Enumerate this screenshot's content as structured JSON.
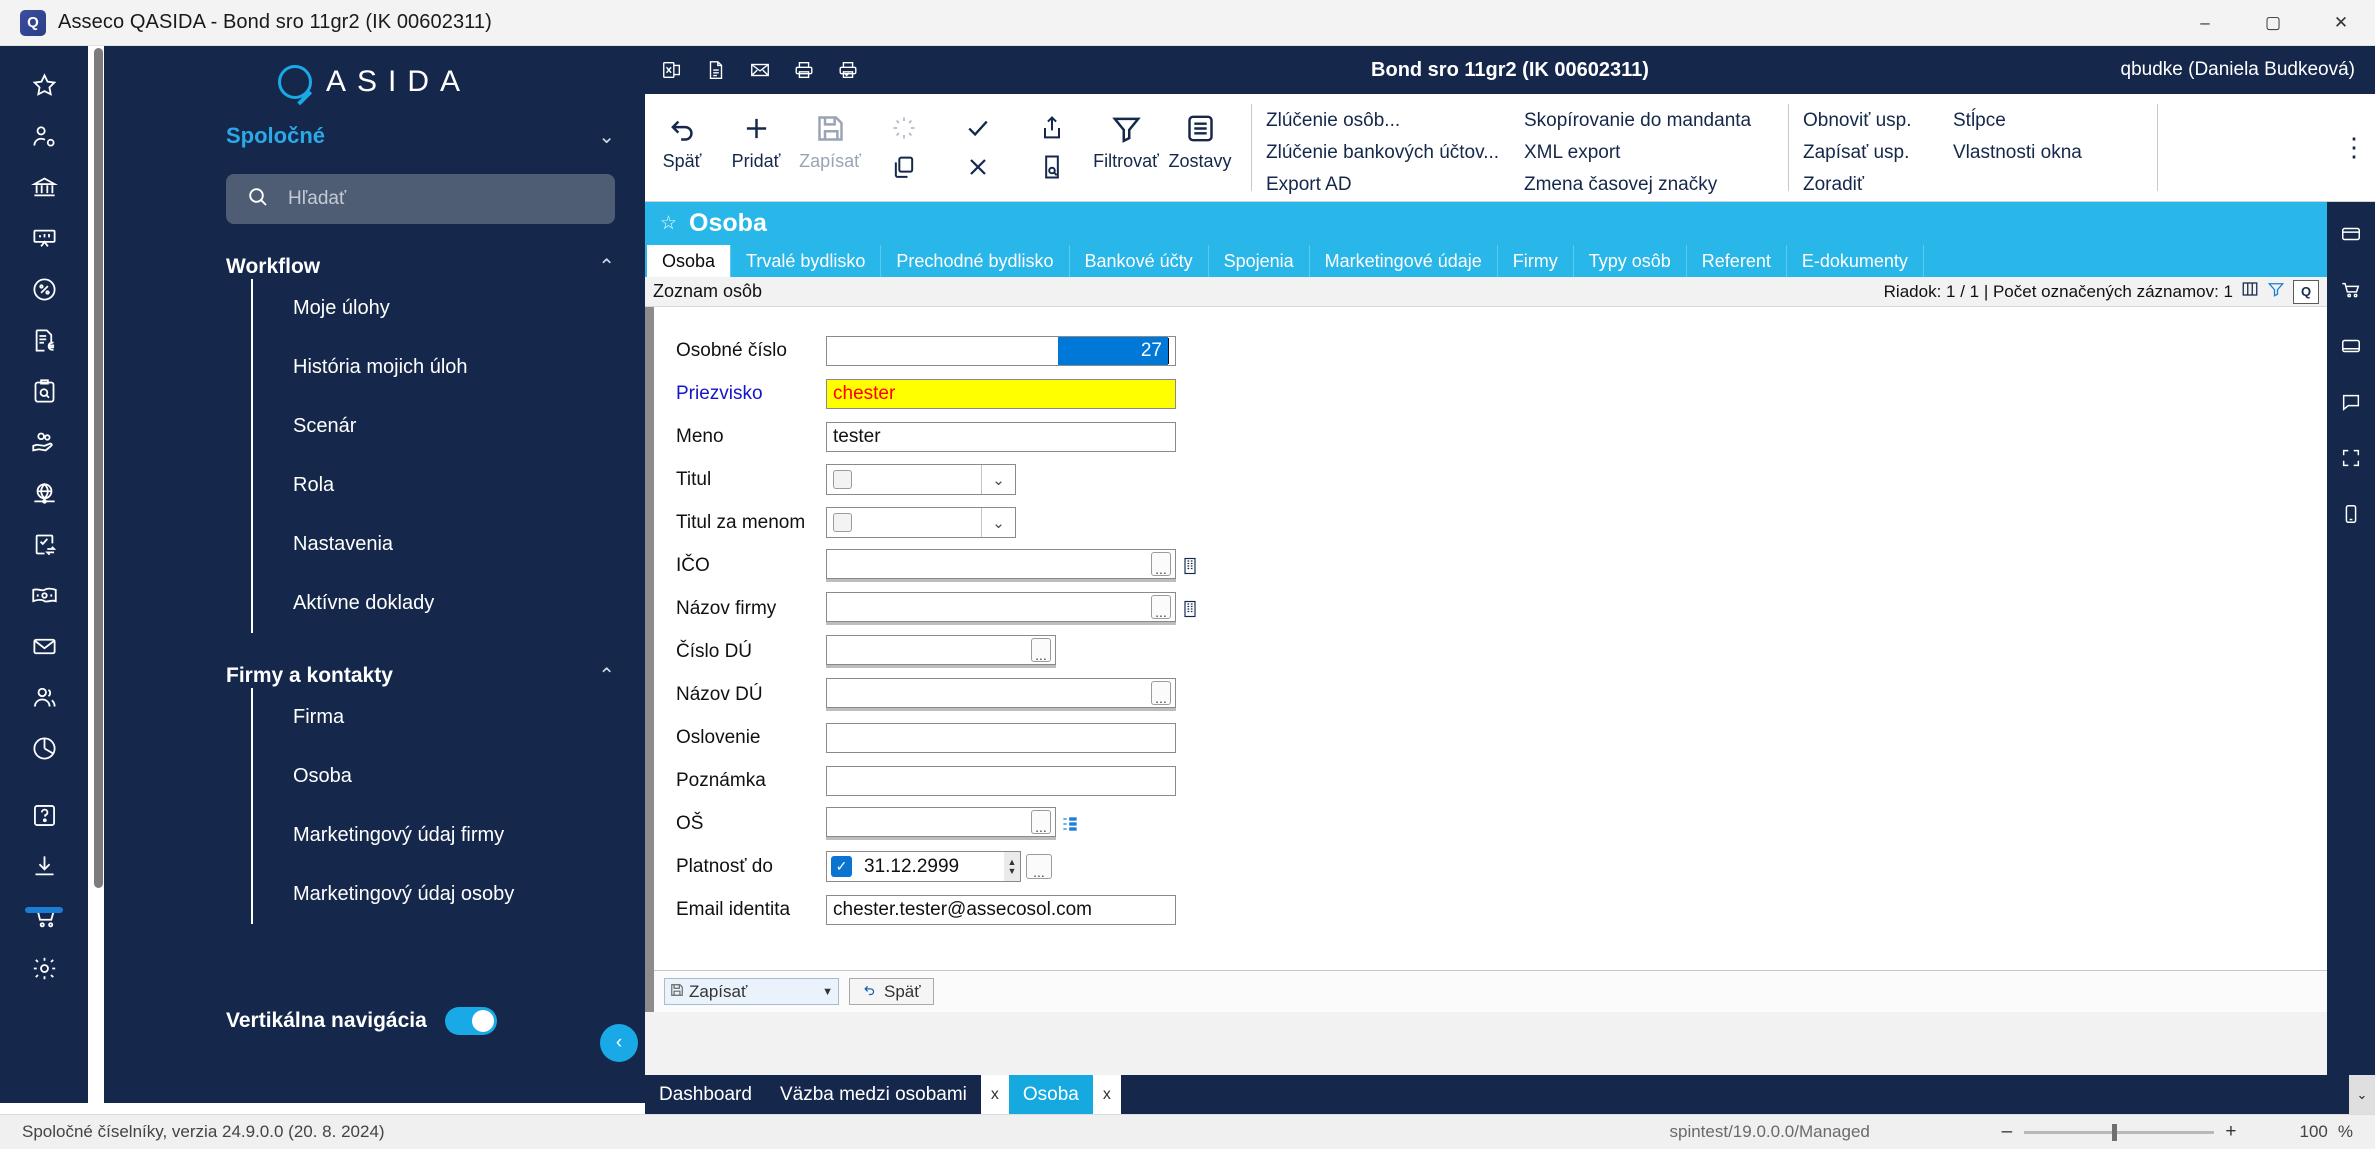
{
  "window": {
    "title": "Asseco QASIDA - Bond sro 11gr2 (IK 00602311)",
    "app_icon": "qasida-logo-icon",
    "minimize": "–",
    "maximize": "▢",
    "close": "✕"
  },
  "rail": {
    "items": [
      {
        "name": "star-icon",
        "label": "Obľúbené"
      },
      {
        "name": "user-settings-icon",
        "label": "Používateľ"
      },
      {
        "name": "bank-icon",
        "label": "Banka"
      },
      {
        "name": "presentation-icon",
        "label": "Prezentácia"
      },
      {
        "name": "percent-circle-icon",
        "label": "Úroky"
      },
      {
        "name": "invoice-euro-icon",
        "label": "Faktúry"
      },
      {
        "name": "clipboard-search-icon",
        "label": "Kontrola"
      },
      {
        "name": "hand-coins-icon",
        "label": "Platby"
      },
      {
        "name": "globe-icon",
        "label": "Globálne"
      },
      {
        "name": "task-transfer-icon",
        "label": "Prevody"
      },
      {
        "name": "banknote-icon",
        "label": "Hotovosť"
      },
      {
        "name": "mail-icon",
        "label": "Pošta"
      },
      {
        "name": "users-icon",
        "label": "Osoby"
      },
      {
        "name": "pie-chart-icon",
        "label": "Reporty"
      },
      {
        "name": "help-circle-icon",
        "label": "Pomoc"
      },
      {
        "name": "download-icon",
        "label": "Stiahnuť"
      },
      {
        "name": "cart-icon",
        "label": "Objednávky"
      },
      {
        "name": "gear-icon",
        "label": "Nastavenia"
      }
    ]
  },
  "navpanel": {
    "brand": "ASIDA",
    "section_title": "Spoločné",
    "section_chevron": "⌄",
    "search": {
      "placeholder": "Hľadať",
      "icon": "search-icon"
    },
    "groups": [
      {
        "title": "Workflow",
        "chevron": "⌃",
        "items": [
          {
            "label": "Moje úlohy"
          },
          {
            "label": "História mojich úloh"
          },
          {
            "label": "Scenár"
          },
          {
            "label": "Rola"
          },
          {
            "label": "Nastavenia"
          },
          {
            "label": "Aktívne doklady"
          }
        ]
      },
      {
        "title": "Firmy a kontakty",
        "chevron": "⌃",
        "items": [
          {
            "label": "Firma"
          },
          {
            "label": "Osoba"
          },
          {
            "label": "Marketingový údaj firmy"
          },
          {
            "label": "Marketingový údaj osoby"
          }
        ]
      }
    ],
    "vertical_nav_label": "Vertikálna navigácia",
    "vertical_nav_on": true,
    "collapse_icon": "‹"
  },
  "appheader": {
    "title": "Bond sro 11gr2 (IK 00602311)",
    "user": "qbudke (Daniela Budkeová)",
    "icons": [
      {
        "name": "excel-export-icon"
      },
      {
        "name": "document-icon"
      },
      {
        "name": "email-icon"
      },
      {
        "name": "print-icon"
      },
      {
        "name": "print-preview-icon"
      }
    ]
  },
  "ribbon": {
    "buttons": [
      {
        "label": "Späť",
        "icon": "undo-icon",
        "disabled": false
      },
      {
        "label": "Pridať",
        "icon": "plus-icon",
        "disabled": false
      },
      {
        "label": "Zapísať",
        "icon": "save-icon",
        "disabled": true
      },
      {
        "label": "Filtrovať",
        "icon": "filter-icon",
        "disabled": false
      },
      {
        "label": "Zostavy",
        "icon": "reports-icon",
        "disabled": false
      }
    ],
    "small_icons": [
      {
        "name": "refresh-icon"
      },
      {
        "name": "copy-icon"
      },
      {
        "name": "check-icon"
      },
      {
        "name": "close-x-icon"
      },
      {
        "name": "share-icon"
      },
      {
        "name": "search-doc-icon"
      }
    ],
    "menu_col1": [
      "Zlúčenie osôb...",
      "Zlúčenie bankových účtov...",
      "Export AD"
    ],
    "menu_col2": [
      "Skopírovanie do mandanta",
      "XML export",
      "Zmena časovej značky"
    ],
    "menu_col3": [
      "Obnoviť usp.",
      "Zapísať usp.",
      "Zoradiť"
    ],
    "menu_col4": [
      "Stĺpce",
      "Vlastnosti okna"
    ],
    "overflow_icon": "⋮"
  },
  "workarea": {
    "star_icon": "☆",
    "title": "Osoba",
    "tabs": [
      {
        "label": "Osoba",
        "active": true
      },
      {
        "label": "Trvalé bydlisko",
        "active": false
      },
      {
        "label": "Prechodné bydlisko",
        "active": false
      },
      {
        "label": "Bankové účty",
        "active": false
      },
      {
        "label": "Spojenia",
        "active": false
      },
      {
        "label": "Marketingové údaje",
        "active": false
      },
      {
        "label": "Firmy",
        "active": false
      },
      {
        "label": "Typy osôb",
        "active": false
      },
      {
        "label": "Referent",
        "active": false
      },
      {
        "label": "E-dokumenty",
        "active": false
      }
    ],
    "subbar_left": "Zoznam osôb",
    "subbar_right": "Riadok: 1 / 1 | Počet označených záznamov: 1",
    "subbar_badge": "Q"
  },
  "form": {
    "fields": [
      {
        "label": "Osobné číslo",
        "type": "text-selected",
        "value": "27"
      },
      {
        "label": "Priezvisko",
        "type": "text-yellow",
        "value": "chester",
        "required": true
      },
      {
        "label": "Meno",
        "type": "text",
        "value": "tester"
      },
      {
        "label": "Titul",
        "type": "combo-check",
        "value": ""
      },
      {
        "label": "Titul za menom",
        "type": "combo-check",
        "value": ""
      },
      {
        "label": "IČO",
        "type": "lookup-building",
        "value": ""
      },
      {
        "label": "Názov firmy",
        "type": "lookup-building",
        "value": ""
      },
      {
        "label": "Číslo DÚ",
        "type": "lookup-short",
        "value": ""
      },
      {
        "label": "Názov DÚ",
        "type": "lookup",
        "value": ""
      },
      {
        "label": "Oslovenie",
        "type": "text",
        "value": ""
      },
      {
        "label": "Poznámka",
        "type": "text",
        "value": ""
      },
      {
        "label": "OŠ",
        "type": "lookup-list",
        "value": ""
      },
      {
        "label": "Platnosť do",
        "type": "date-check",
        "value": "31.12.2999",
        "checked": true
      },
      {
        "label": "Email identita",
        "type": "text",
        "value": "chester.tester@assecosol.com"
      }
    ],
    "footer": {
      "save_label": "Zapísať",
      "save_icon": "save-icon",
      "dropdown_arrow": "▼",
      "back_label": "Späť",
      "back_icon": "undo-icon"
    }
  },
  "doctabs": {
    "tabs": [
      {
        "label": "Dashboard",
        "active": false,
        "closable": false
      },
      {
        "label": "Väzba medzi osobami",
        "active": false,
        "closable": true
      },
      {
        "label": "Osoba",
        "active": true,
        "closable": true
      }
    ],
    "close_label": "x",
    "scroll_icon": "⌄"
  },
  "rightdock": {
    "items": [
      {
        "name": "window-icon"
      },
      {
        "name": "cart-dock-icon"
      },
      {
        "name": "minimize-panel-icon"
      },
      {
        "name": "comment-icon"
      },
      {
        "name": "fullscreen-icon"
      },
      {
        "name": "mobile-icon"
      }
    ]
  },
  "statusbar": {
    "left": "Spoločné číselníky, verzia 24.9.0.0 (20. 8. 2024)",
    "version": "spintest/19.0.0.0/Managed",
    "zoom_minus": "–",
    "zoom_plus": "+",
    "zoom_value": "100",
    "zoom_pct": "%"
  }
}
